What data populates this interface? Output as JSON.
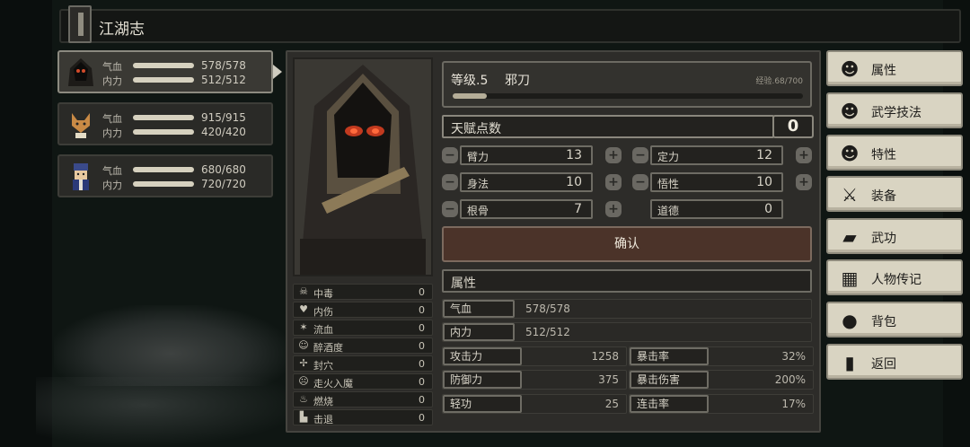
{
  "header": {
    "title": "江湖志"
  },
  "party": [
    {
      "hp_label": "气血",
      "hp": "578/578",
      "mp_label": "内力",
      "mp": "512/512",
      "selected": true
    },
    {
      "hp_label": "气血",
      "hp": "915/915",
      "mp_label": "内力",
      "mp": "420/420",
      "selected": false
    },
    {
      "hp_label": "气血",
      "hp": "680/680",
      "mp_label": "内力",
      "mp": "720/720",
      "selected": false
    }
  ],
  "status_effects": [
    {
      "icon": "skull-icon",
      "name": "中毒",
      "value": "0"
    },
    {
      "icon": "broken-heart-icon",
      "name": "内伤",
      "value": "0"
    },
    {
      "icon": "blood-splatter-icon",
      "name": "流血",
      "value": "0"
    },
    {
      "icon": "drunk-face-icon",
      "name": "醉酒度",
      "value": "0"
    },
    {
      "icon": "acupoint-seal-icon",
      "name": "封穴",
      "value": "0"
    },
    {
      "icon": "demon-face-icon",
      "name": "走火入魔",
      "value": "0"
    },
    {
      "icon": "flame-icon",
      "name": "燃烧",
      "value": "0"
    },
    {
      "icon": "knockback-boot-icon",
      "name": "击退",
      "value": "0"
    }
  ],
  "level": {
    "label": "等级.5",
    "class": "邪刀",
    "exp_text": "经验.68/700",
    "exp_current": 68,
    "exp_max": 700
  },
  "talent": {
    "label": "天赋点数",
    "value": "0"
  },
  "stats": [
    {
      "label": "臂力",
      "value": "13"
    },
    {
      "label": "定力",
      "value": "12"
    },
    {
      "label": "身法",
      "value": "10"
    },
    {
      "label": "悟性",
      "value": "10"
    },
    {
      "label": "根骨",
      "value": "7"
    },
    {
      "label": "道德",
      "value": "0"
    }
  ],
  "confirm_label": "确认",
  "attributes": {
    "header": "属性",
    "hp_label": "气血",
    "hp_value": "578/578",
    "mp_label": "内力",
    "mp_value": "512/512",
    "combat": [
      {
        "label": "攻击力",
        "value": "1258"
      },
      {
        "label": "暴击率",
        "value": "32%"
      },
      {
        "label": "防御力",
        "value": "375"
      },
      {
        "label": "暴击伤害",
        "value": "200%"
      },
      {
        "label": "轻功",
        "value": "25"
      },
      {
        "label": "连击率",
        "value": "17%"
      }
    ]
  },
  "menu": [
    {
      "icon": "character-icon",
      "label": "属性"
    },
    {
      "icon": "character-skills-icon",
      "label": "武学技法"
    },
    {
      "icon": "character-trait-icon",
      "label": "特性"
    },
    {
      "icon": "sword-icon",
      "label": "装备"
    },
    {
      "icon": "scroll-book-icon",
      "label": "武功"
    },
    {
      "icon": "biography-book-icon",
      "label": "人物传记"
    },
    {
      "icon": "bag-icon",
      "label": "背包"
    },
    {
      "icon": "door-icon",
      "label": "返回"
    }
  ],
  "colors": {
    "background": "#0f1613",
    "panel": "#2d2c29",
    "confirm": "#4b3329",
    "menu": "#d9d4c2"
  }
}
